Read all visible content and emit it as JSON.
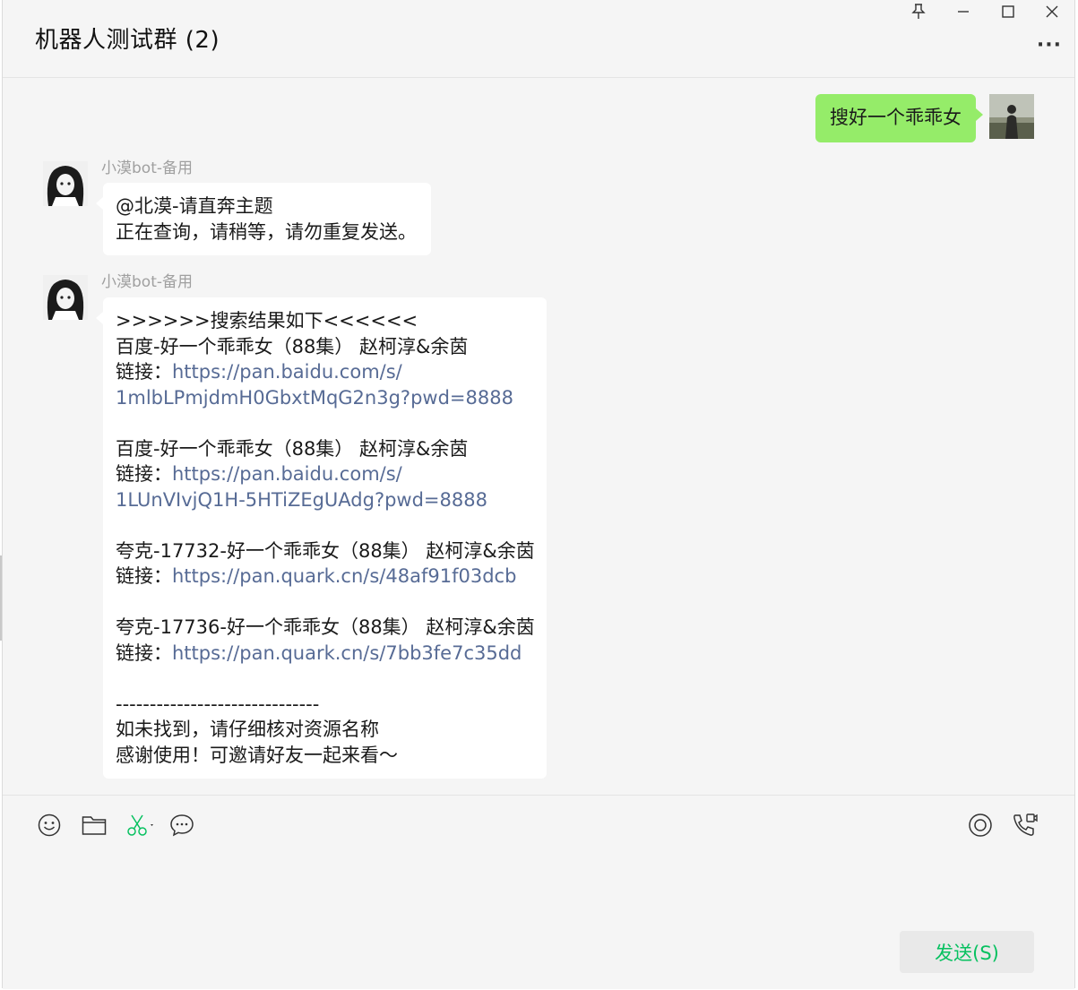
{
  "window": {
    "title": "机器人测试群 (2)",
    "pin_glyph": "⚲",
    "minimize_glyph": "—",
    "maximize_glyph": "☐",
    "close_glyph": "✕",
    "more_glyph": "···"
  },
  "messages": [
    {
      "direction": "out",
      "text": "搜好一个乖乖女"
    },
    {
      "direction": "in",
      "sender": "小漠bot-备用",
      "lines": [
        "@北漠-请直奔主题",
        "正在查询，请稍等，请勿重复发送。"
      ]
    },
    {
      "direction": "in",
      "sender": "小漠bot-备用",
      "header": ">>>>>>搜索结果如下<<<<<<",
      "results": [
        {
          "title": "百度-好一个乖乖女（88集） 赵柯淳&余茵",
          "link_label": "链接：",
          "link_line1": "https://pan.baidu.com/s/",
          "link_line2": "1mlbLPmjdmH0GbxtMqG2n3g?pwd=8888"
        },
        {
          "title": "百度-好一个乖乖女（88集） 赵柯淳&余茵",
          "link_label": "链接：",
          "link_line1": "https://pan.baidu.com/s/",
          "link_line2": "1LUnVIvjQ1H-5HTiZEgUAdg?pwd=8888"
        },
        {
          "title": "夸克-17732-好一个乖乖女（88集） 赵柯淳&余茵",
          "link_label": "链接：",
          "link_line1": "https://pan.quark.cn/s/48af91f03dcb"
        },
        {
          "title": "夸克-17736-好一个乖乖女（88集） 赵柯淳&余茵",
          "link_label": "链接：",
          "link_line1": "https://pan.quark.cn/s/7bb3fe7c35dd"
        }
      ],
      "divider": "------------------------------",
      "footer1": "如未找到，请仔细核对资源名称",
      "footer2": "感谢使用！可邀请好友一起来看～"
    }
  ],
  "toolbar": {
    "send_label": "发送(S)"
  },
  "colors": {
    "accent": "#07c160",
    "out_bubble": "#95ec69",
    "link": "#576b95"
  }
}
